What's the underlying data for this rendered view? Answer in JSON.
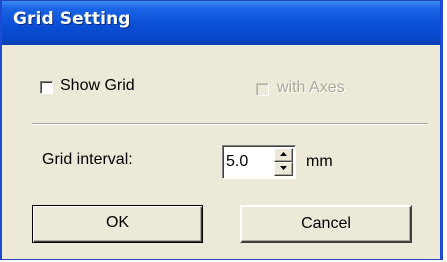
{
  "window": {
    "title": "Grid Setting"
  },
  "options": {
    "show_grid": {
      "label": "Show Grid",
      "checked": false,
      "enabled": true
    },
    "with_axes": {
      "label": "with Axes",
      "checked": false,
      "enabled": false
    }
  },
  "grid_interval": {
    "label": "Grid interval:",
    "value": "5.0",
    "unit": "mm"
  },
  "buttons": {
    "ok_label": "OK",
    "cancel_label": "Cancel"
  },
  "colors": {
    "titlebar": "#0a4fd6",
    "dialog_bg": "#ece9d8",
    "disabled_text": "#aca899"
  }
}
